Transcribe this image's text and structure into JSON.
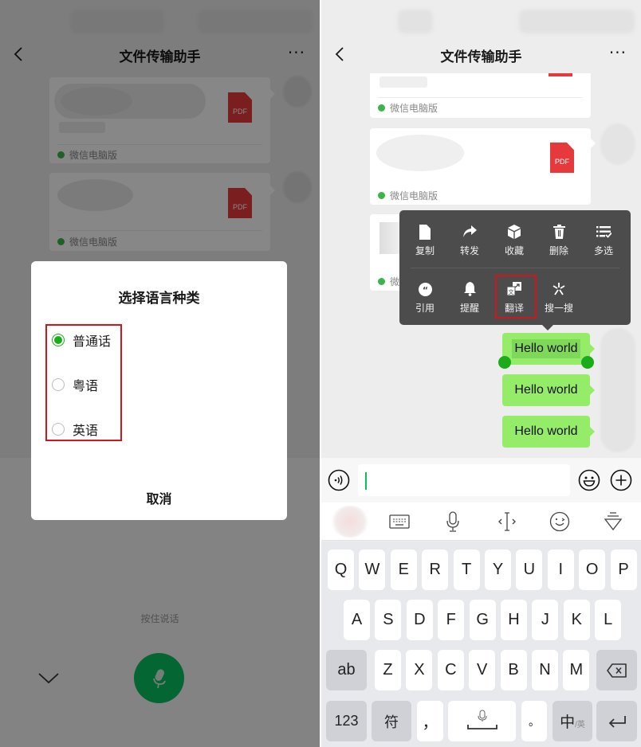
{
  "left_screen": {
    "header": {
      "title": "文件传输助手",
      "back_icon": "chevron-left-icon",
      "more_label": "···"
    },
    "cards": [
      {
        "file_type": "PDF",
        "source": "微信电脑版"
      },
      {
        "file_type": "PDF",
        "source": "微信电脑版"
      }
    ],
    "dialog": {
      "title": "选择语言种类",
      "options": [
        {
          "label": "普通话",
          "selected": true
        },
        {
          "label": "粤语",
          "selected": false
        },
        {
          "label": "英语",
          "selected": false
        }
      ],
      "cancel_label": "取消"
    },
    "voice": {
      "hint": "按住说话",
      "collapse_icon": "chevron-down-icon",
      "mic_icon": "microphone-icon"
    }
  },
  "right_screen": {
    "header": {
      "title": "文件传输助手",
      "back_icon": "chevron-left-icon",
      "more_label": "···"
    },
    "cards": [
      {
        "file_type": "PDF",
        "source": "微信电脑版"
      },
      {
        "file_type": "PDF",
        "source": "微信电脑版"
      },
      {
        "source": "微"
      }
    ],
    "context_menu": {
      "row1": [
        {
          "label": "复制",
          "icon": "copy-icon"
        },
        {
          "label": "转发",
          "icon": "forward-icon"
        },
        {
          "label": "收藏",
          "icon": "favorite-icon"
        },
        {
          "label": "删除",
          "icon": "delete-icon"
        },
        {
          "label": "多选",
          "icon": "multi-select-icon"
        }
      ],
      "row2": [
        {
          "label": "引用",
          "icon": "quote-icon"
        },
        {
          "label": "提醒",
          "icon": "bell-icon"
        },
        {
          "label": "翻译",
          "icon": "translate-icon",
          "highlighted": true
        },
        {
          "label": "搜一搜",
          "icon": "search-sparkle-icon"
        }
      ]
    },
    "messages": [
      {
        "text": "Hello world",
        "selected": true
      },
      {
        "text": "Hello world",
        "selected": false
      },
      {
        "text": "Hello world",
        "selected": false
      }
    ],
    "input": {
      "value": "",
      "voice_icon": "voice-icon",
      "emoji_icon": "emoji-icon",
      "plus_icon": "plus-icon"
    },
    "keyboard_toolbar": [
      "keyboard-icon",
      "microphone-icon",
      "cursor-icon",
      "emoticon-icon",
      "hide-keyboard-icon"
    ],
    "keyboard": {
      "row1": [
        "Q",
        "W",
        "E",
        "R",
        "T",
        "Y",
        "U",
        "I",
        "O",
        "P"
      ],
      "row2": [
        "A",
        "S",
        "D",
        "F",
        "G",
        "H",
        "J",
        "K",
        "L"
      ],
      "row3": [
        "Z",
        "X",
        "C",
        "V",
        "B",
        "N",
        "M"
      ],
      "shift_label": "ab",
      "numbers_label": "123",
      "symbols_label": "符",
      "comma_label": "，",
      "period_label": "。",
      "lang_label": "中",
      "lang_sub_label": "/英"
    }
  }
}
